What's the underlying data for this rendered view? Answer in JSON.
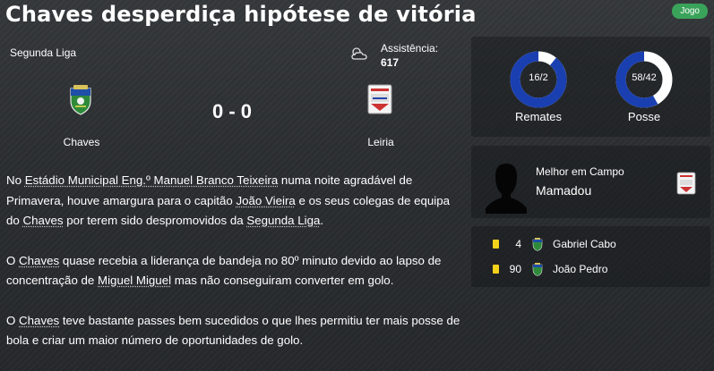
{
  "header": {
    "title": "Chaves desperdiça hipótese de vitória",
    "badge": "Jogo"
  },
  "match": {
    "competition": "Segunda Liga",
    "attendance_label": "Assistência:",
    "attendance_value": "617",
    "weather_icon": "cloudy-icon",
    "score": "0 - 0",
    "home_team": "Chaves",
    "away_team": "Leiria"
  },
  "stats": {
    "shots": {
      "label": "Remates",
      "value": "16/2",
      "home_fraction": 0.89
    },
    "possession": {
      "label": "Posse",
      "value": "58/42",
      "home_fraction": 0.58
    },
    "colors": {
      "home": "#1a3fb0",
      "away": "#ffffff"
    }
  },
  "motm": {
    "label": "Melhor em Campo",
    "name": "Mamadou"
  },
  "events": [
    {
      "minute": "4",
      "player": "Gabriel Cabo",
      "type": "yellow-card"
    },
    {
      "minute": "90",
      "player": "João Pedro",
      "type": "yellow-card"
    }
  ],
  "report": {
    "p1": [
      "No ",
      {
        "link": "Estádio Municipal Eng.º Manuel Branco Teixeira"
      },
      " numa noite agradável de Primavera, houve amargura para o capitão ",
      {
        "link": "João Vieira"
      },
      " e os seus colegas de equipa do ",
      {
        "link": "Chaves"
      },
      " por terem sido despromovidos da ",
      {
        "link": "Segunda Liga"
      },
      "."
    ],
    "p2": [
      "O ",
      {
        "link": "Chaves"
      },
      " quase recebia a liderança de bandeja no 80º minuto devido ao lapso de concentração de ",
      {
        "link": "Miguel Miguel"
      },
      " mas não conseguiram converter em golo."
    ],
    "p3": [
      "O ",
      {
        "link": "Chaves"
      },
      " teve bastante passes bem sucedidos o que lhes permitiu ter mais posse de bola e criar um maior número de oportunidades de golo."
    ]
  }
}
